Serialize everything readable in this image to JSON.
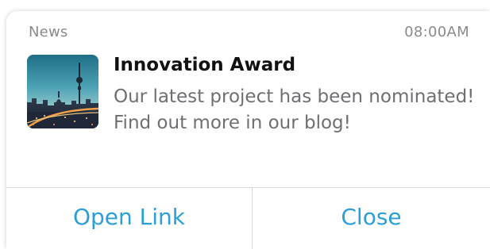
{
  "notification": {
    "app_name": "News",
    "time": "08:00AM",
    "title": "Innovation Award",
    "body": "Our latest project has been nominated! Find out more in our blog!",
    "thumbnail_icon": "city-skyline-photo"
  },
  "actions": {
    "open_label": "Open Link",
    "close_label": "Close"
  },
  "colors": {
    "accent": "#2a9fd8",
    "title": "#111111",
    "secondary_text": "#6f6f73",
    "meta_text": "#8a8a8e"
  }
}
